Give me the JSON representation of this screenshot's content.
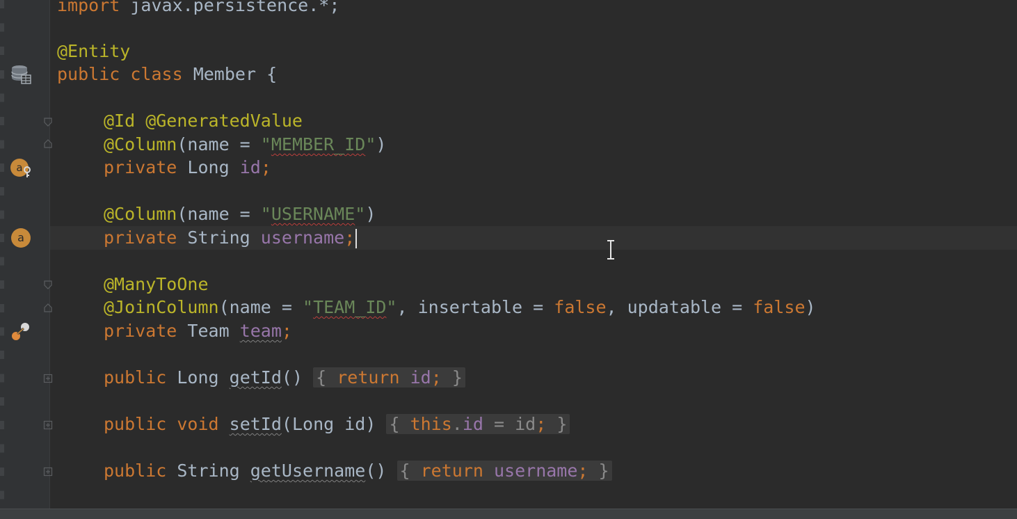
{
  "editor": {
    "lines": {
      "l0": {
        "import_kw": "import",
        "pkg": " javax.persistence.*;"
      },
      "l2": {
        "ann": "@Entity"
      },
      "l3": {
        "public_kw": "public",
        "class_kw": "class",
        "name": "Member",
        "brace": "{"
      },
      "l5": {
        "ann": "@Id @GeneratedValue"
      },
      "l6": {
        "ann": "@Column",
        "open": "(name = ",
        "str_q1": "\"",
        "str_val": "MEMBER_ID",
        "str_q2": "\"",
        "close": ")"
      },
      "l7": {
        "private_kw": "private",
        "type": "Long",
        "field": "id",
        "semi": ";"
      },
      "l9": {
        "ann": "@Column",
        "open": "(name = ",
        "str_q1": "\"",
        "str_val": "USERNAME",
        "str_q2": "\"",
        "close": ")"
      },
      "l10": {
        "private_kw": "private",
        "type": "String",
        "field": "username",
        "semi": ";"
      },
      "l12": {
        "ann": "@ManyToOne"
      },
      "l13": {
        "ann": "@JoinColumn",
        "open": "(name = ",
        "str_q1": "\"",
        "str_val": "TEAM_ID",
        "str_q2": "\"",
        "mid1": ", insertable = ",
        "false1": "false",
        "mid2": ", updatable = ",
        "false2": "false",
        "close": ")"
      },
      "l14": {
        "private_kw": "private",
        "type": "Team",
        "field": "team",
        "semi": ";"
      },
      "l16": {
        "public_kw": "public",
        "type": "Long",
        "method": "getId",
        "parens": "()",
        "body_open": "{",
        "return_kw": "return",
        "field": "id",
        "semi": ";",
        "body_close": "}"
      },
      "l18": {
        "public_kw": "public",
        "void_kw": "void",
        "method": "setId",
        "params": "(Long id)",
        "body_open": "{",
        "this_kw": "this",
        "dot": ".",
        "field": "id",
        "assign": " = id",
        "semi": ";",
        "body_close": "}"
      },
      "l20": {
        "public_kw": "public",
        "type": "String",
        "method": "getUsername",
        "parens": "()",
        "body_open": "{",
        "return_kw": "return",
        "field": "username",
        "semi": ";",
        "body_close": "}"
      }
    },
    "gutter_icons": [
      "database-table-icon",
      "field-key-icon",
      "field-icon",
      "relation-link-icon"
    ],
    "colors": {
      "background": "#2b2b2b",
      "keyword": "#cc7832",
      "annotation": "#bbb529",
      "string": "#6a8759",
      "field": "#9876aa",
      "text": "#a9b7c6",
      "icon_accent": "#c88a3a"
    }
  }
}
